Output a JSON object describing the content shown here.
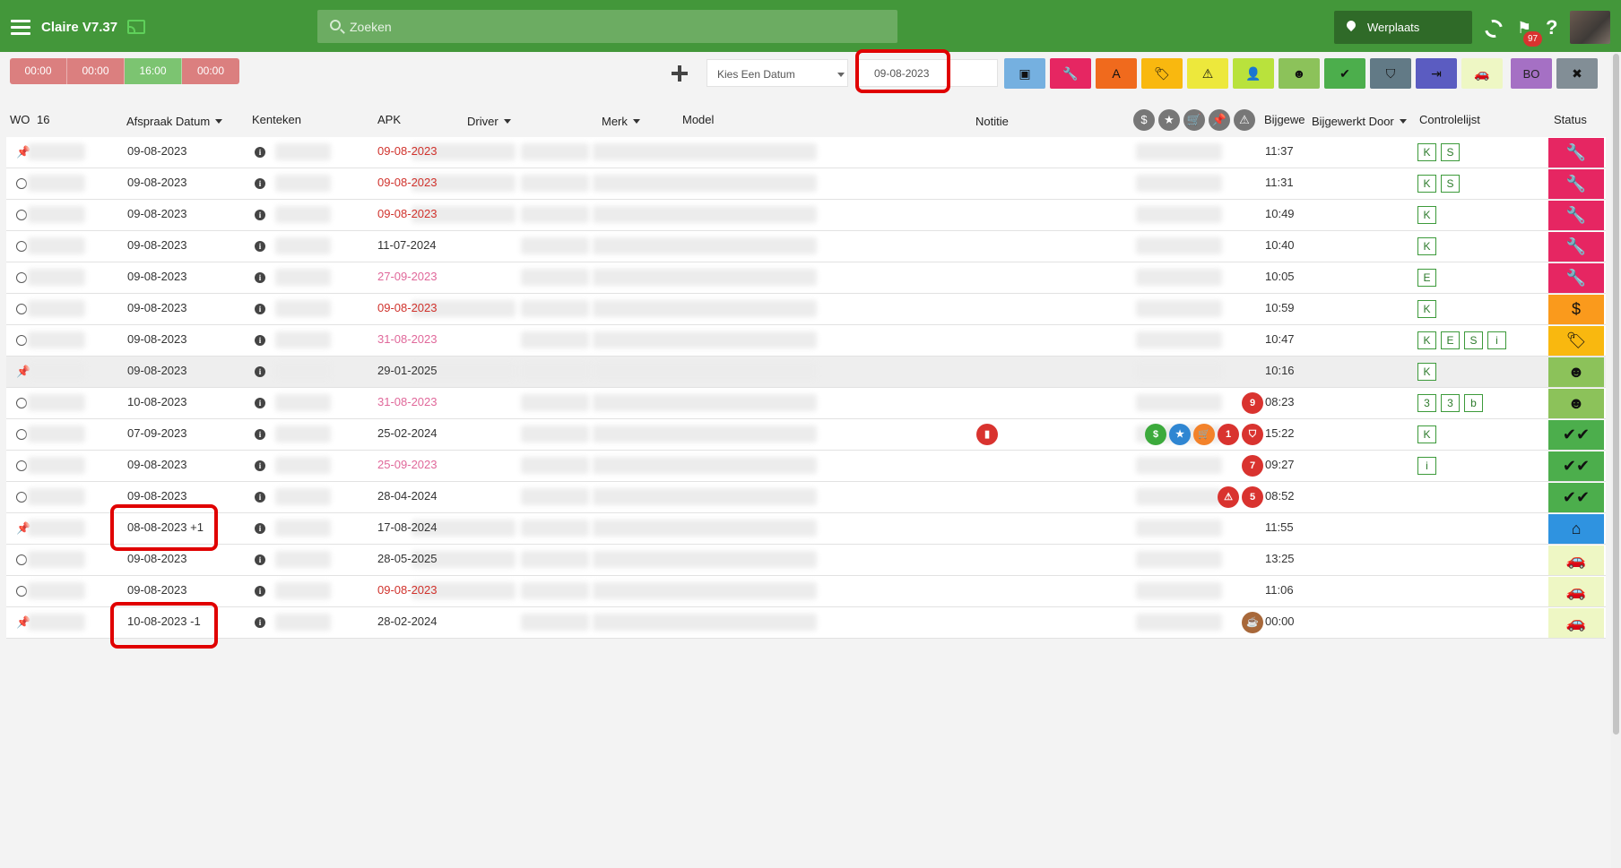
{
  "app": {
    "title": "Claire V7.37",
    "notification_count": "97"
  },
  "search": {
    "placeholder": "Zoeken"
  },
  "location": {
    "label": "Werplaats"
  },
  "timers": [
    {
      "label": "00:00",
      "color": "#db7f7f"
    },
    {
      "label": "00:00",
      "color": "#db7f7f"
    },
    {
      "label": "16:00",
      "color": "#7cc471"
    },
    {
      "label": "00:00",
      "color": "#db7f7f"
    }
  ],
  "date_filter": {
    "select_label": "Kies Een Datum",
    "date_value": "09-08-2023"
  },
  "filter_buttons": [
    {
      "icon": "calendar-icon",
      "color": "#75b0e0",
      "glyph": "▣"
    },
    {
      "icon": "wrench-icon",
      "color": "#e62662",
      "glyph": "🔧"
    },
    {
      "icon": "letter-a-icon",
      "color": "#f06a1d",
      "glyph": "A"
    },
    {
      "icon": "tag-icon",
      "color": "#f9b80f",
      "glyph": "🏷"
    },
    {
      "icon": "warning-icon",
      "color": "#ede83c",
      "glyph": "⚠"
    },
    {
      "icon": "user-check-icon",
      "color": "#b9e23c",
      "glyph": "👤"
    },
    {
      "icon": "smiley-icon",
      "color": "#8cc25a",
      "glyph": "☻"
    },
    {
      "icon": "double-check-icon",
      "color": "#4cae4c",
      "glyph": "✔"
    },
    {
      "icon": "shield-icon",
      "color": "#627a86",
      "glyph": "⛉"
    },
    {
      "icon": "sign-out-icon",
      "color": "#5b5cc1",
      "glyph": "⇥"
    },
    {
      "icon": "car-icon",
      "color": "#eef7c4",
      "glyph": "🚗"
    },
    {
      "icon": "bo-label",
      "color": "#a570c4",
      "glyph": "BO"
    },
    {
      "icon": "close-circle-icon",
      "color": "#828e96",
      "glyph": "✖"
    }
  ],
  "table": {
    "headers": {
      "wo": "WO",
      "count": "16",
      "afspraak_datum": "Afspraak Datum",
      "kenteken": "Kenteken",
      "apk": "APK",
      "driver": "Driver",
      "merk": "Merk",
      "model": "Model",
      "notitie": "Notitie",
      "bijgewerkt": "Bijgewe",
      "bijgewerkt_door": "Bijgewerkt Door",
      "controlelijst": "Controlelijst",
      "status": "Status"
    },
    "icon_headers": [
      "$",
      "★",
      "🛒",
      "📌",
      "⚠"
    ],
    "rows": [
      {
        "marker": "pin",
        "date": "09-08-2023",
        "apk": "09-08-2023",
        "apk_color": "red",
        "time": "11:37",
        "checks": [
          "K",
          "S"
        ],
        "status": "wrench",
        "status_color": "#e62662"
      },
      {
        "marker": "radio",
        "date": "09-08-2023",
        "apk": "09-08-2023",
        "apk_color": "red",
        "time": "11:31",
        "checks": [
          "K",
          "S"
        ],
        "status": "wrench",
        "status_color": "#e62662"
      },
      {
        "marker": "radio",
        "date": "09-08-2023",
        "apk": "09-08-2023",
        "apk_color": "red",
        "time": "10:49",
        "checks": [
          "K"
        ],
        "status": "wrench",
        "status_color": "#e62662"
      },
      {
        "marker": "radio",
        "date": "09-08-2023",
        "apk": "11-07-2024",
        "apk_color": "dark",
        "time": "10:40",
        "checks": [
          "K"
        ],
        "status": "wrench",
        "status_color": "#e62662"
      },
      {
        "marker": "radio",
        "date": "09-08-2023",
        "apk": "27-09-2023",
        "apk_color": "pink",
        "time": "10:05",
        "checks": [
          "E"
        ],
        "status": "wrench",
        "status_color": "#e62662"
      },
      {
        "marker": "radio",
        "date": "09-08-2023",
        "apk": "09-08-2023",
        "apk_color": "red",
        "time": "10:59",
        "checks": [
          "K"
        ],
        "status": "dollar",
        "status_color": "#fa9a1c"
      },
      {
        "marker": "radio",
        "date": "09-08-2023",
        "apk": "31-08-2023",
        "apk_color": "pink",
        "time": "10:47",
        "checks": [
          "K",
          "E",
          "S",
          "i"
        ],
        "status": "tag",
        "status_color": "#f9b80f"
      },
      {
        "marker": "pin",
        "date": "09-08-2023",
        "apk": "29-01-2025",
        "apk_color": "dark",
        "time": "10:16",
        "checks": [
          "K"
        ],
        "status": "smiley",
        "status_color": "#8cc25a"
      },
      {
        "marker": "radio",
        "date": "10-08-2023",
        "apk": "31-08-2023",
        "apk_color": "pink",
        "time": "08:23",
        "checks": [
          "3",
          "3",
          "b"
        ],
        "status": "smiley",
        "status_color": "#8cc25a",
        "bubbles": [
          {
            "text": "9",
            "color": "#d9332f"
          }
        ]
      },
      {
        "marker": "radio",
        "date": "07-09-2023",
        "apk": "25-02-2024",
        "apk_color": "dark",
        "time": "15:22",
        "checks": [
          "K"
        ],
        "status": "double-check",
        "status_color": "#4cae4c",
        "note_bubble": true,
        "bubbles": [
          {
            "text": "$",
            "color": "#3caa3c"
          },
          {
            "text": "★",
            "color": "#2f86d2"
          },
          {
            "text": "🛒",
            "color": "#f3822a"
          },
          {
            "text": "1",
            "color": "#d9332f"
          },
          {
            "text": "⛉",
            "color": "#d9332f"
          }
        ]
      },
      {
        "marker": "radio",
        "date": "09-08-2023",
        "apk": "25-09-2023",
        "apk_color": "pink",
        "time": "09:27",
        "checks": [
          "i"
        ],
        "status": "double-check",
        "status_color": "#4cae4c",
        "bubbles": [
          {
            "text": "7",
            "color": "#d9332f"
          }
        ]
      },
      {
        "marker": "radio",
        "date": "09-08-2023",
        "apk": "28-04-2024",
        "apk_color": "dark",
        "time": "08:52",
        "checks": [],
        "status": "double-check",
        "status_color": "#4cae4c",
        "bubbles": [
          {
            "text": "⚠",
            "color": "#d9332f"
          },
          {
            "text": "5",
            "color": "#d9332f"
          }
        ]
      },
      {
        "marker": "pin",
        "date": "08-08-2023 +1",
        "apk": "17-08-2024",
        "apk_color": "dark",
        "time": "11:55",
        "checks": [],
        "status": "garage",
        "status_color": "#2f93e0"
      },
      {
        "marker": "radio",
        "date": "09-08-2023",
        "apk": "28-05-2025",
        "apk_color": "dark",
        "time": "13:25",
        "checks": [],
        "status": "car",
        "status_color": "#eef7c4"
      },
      {
        "marker": "radio",
        "date": "09-08-2023",
        "apk": "09-08-2023",
        "apk_color": "red",
        "time": "11:06",
        "checks": [],
        "status": "car",
        "status_color": "#eef7c4"
      },
      {
        "marker": "pin",
        "date": "10-08-2023 -1",
        "apk": "28-02-2024",
        "apk_color": "dark",
        "time": "00:00",
        "checks": [],
        "status": "car",
        "status_color": "#eef7c4",
        "bubbles": [
          {
            "text": "☕",
            "color": "#a8683a"
          }
        ]
      }
    ]
  }
}
